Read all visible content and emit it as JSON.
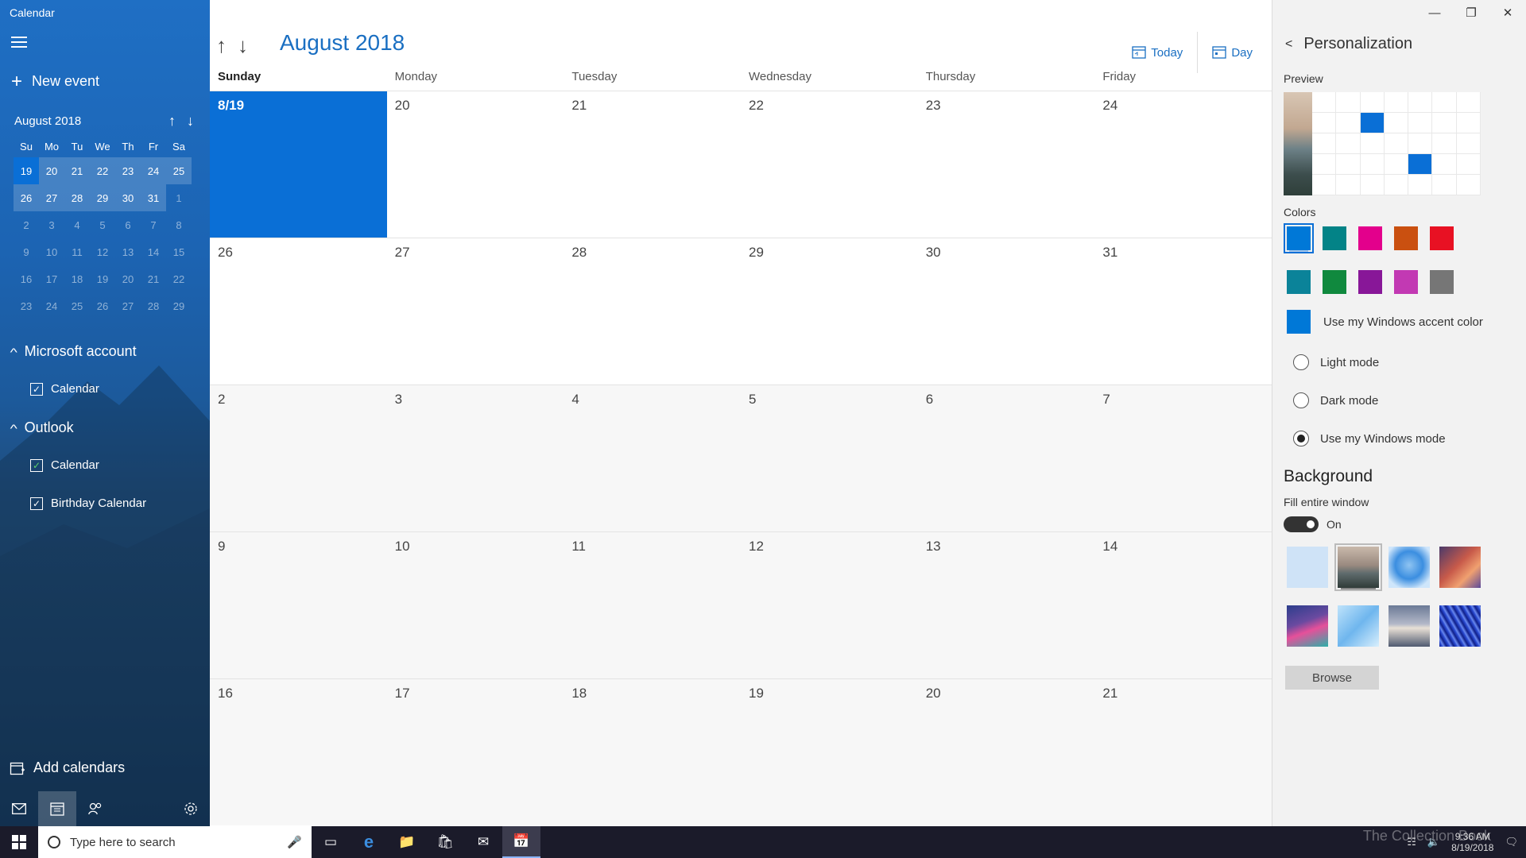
{
  "app": {
    "title": "Calendar"
  },
  "sidebar": {
    "new_event": "New event",
    "mini_calendar": {
      "month": "August 2018",
      "weekdays": [
        "Su",
        "Mo",
        "Tu",
        "We",
        "Th",
        "Fr",
        "Sa"
      ],
      "rows": [
        [
          "19",
          "20",
          "21",
          "22",
          "23",
          "24",
          "25"
        ],
        [
          "26",
          "27",
          "28",
          "29",
          "30",
          "31",
          "1"
        ],
        [
          "2",
          "3",
          "4",
          "5",
          "6",
          "7",
          "8"
        ],
        [
          "9",
          "10",
          "11",
          "12",
          "13",
          "14",
          "15"
        ],
        [
          "16",
          "17",
          "18",
          "19",
          "20",
          "21",
          "22"
        ],
        [
          "23",
          "24",
          "25",
          "26",
          "27",
          "28",
          "29"
        ]
      ]
    },
    "accounts": [
      {
        "name": "Microsoft account",
        "calendars": [
          "Calendar"
        ]
      },
      {
        "name": "Outlook",
        "calendars": [
          "Calendar",
          "Birthday Calendar"
        ]
      }
    ],
    "add_calendars": "Add calendars",
    "icons": [
      "mail-icon",
      "calendar-icon",
      "people-icon",
      "settings-icon"
    ]
  },
  "main": {
    "month_title": "August 2018",
    "today_label": "Today",
    "view_label": "Day",
    "weekdays": [
      "Sunday",
      "Monday",
      "Tuesday",
      "Wednesday",
      "Thursday",
      "Friday"
    ],
    "weeks": [
      [
        "8/19",
        "20",
        "21",
        "22",
        "23",
        "24"
      ],
      [
        "26",
        "27",
        "28",
        "29",
        "30",
        "31"
      ],
      [
        "2",
        "3",
        "4",
        "5",
        "6",
        "7"
      ],
      [
        "9",
        "10",
        "11",
        "12",
        "13",
        "14"
      ],
      [
        "16",
        "17",
        "18",
        "19",
        "20",
        "21"
      ]
    ]
  },
  "personalization": {
    "title": "Personalization",
    "preview_label": "Preview",
    "colors_label": "Colors",
    "colors_row1": [
      "#0078d7",
      "#038387",
      "#e3008c",
      "#ca5010",
      "#e81123"
    ],
    "colors_row2": [
      "#0b8399",
      "#10893e",
      "#881798",
      "#c239b3",
      "#767676"
    ],
    "accent_label": "Use my Windows accent color",
    "modes": [
      "Light mode",
      "Dark mode",
      "Use my Windows mode"
    ],
    "selected_mode": "Use my Windows mode",
    "background_label": "Background",
    "fill_label": "Fill entire window",
    "toggle_state": "On",
    "browse_label": "Browse"
  },
  "taskbar": {
    "search_placeholder": "Type here to search",
    "time": "9:36 AM",
    "date": "8/19/2018",
    "watermark": "The Collection Book"
  }
}
